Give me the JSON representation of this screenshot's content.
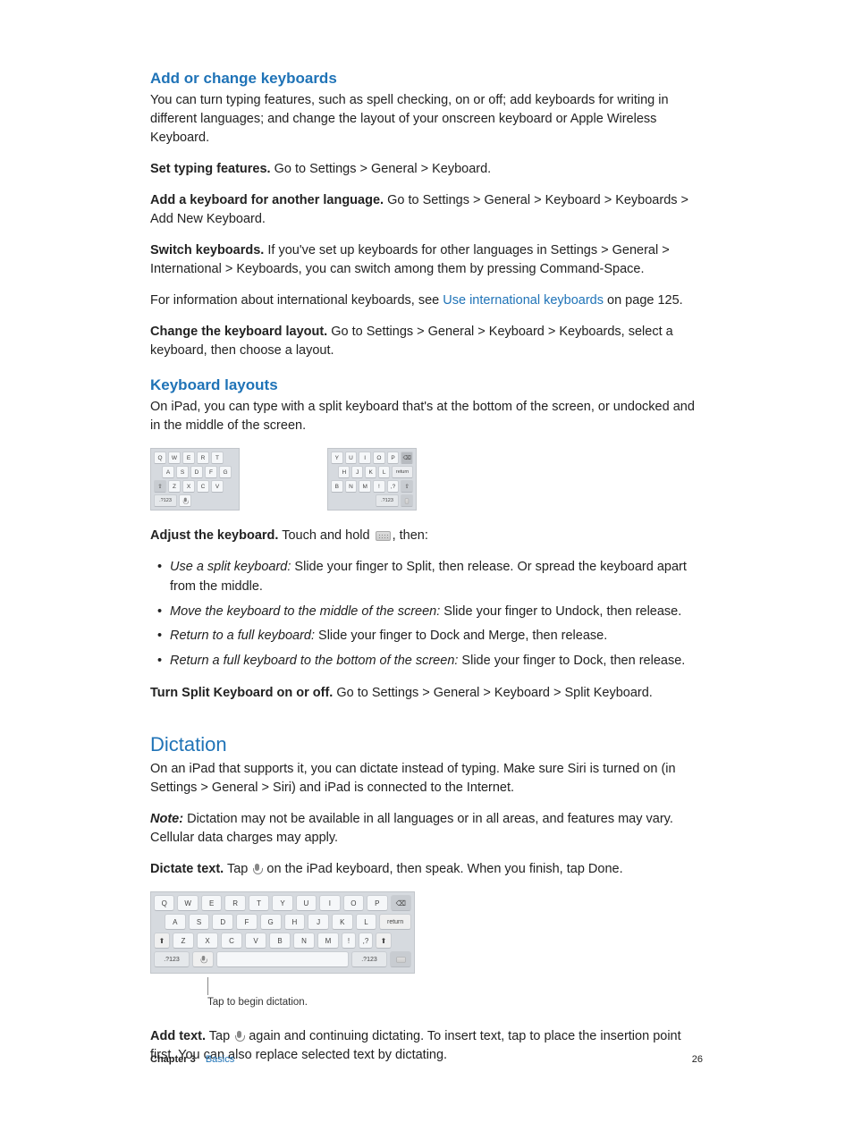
{
  "section1": {
    "heading": "Add or change keyboards",
    "intro": "You can turn typing features, such as spell checking, on or off; add keyboards for writing in different languages; and change the layout of your onscreen keyboard or Apple Wireless Keyboard.",
    "p1_bold": "Set typing features.",
    "p1_rest": " Go to Settings > General > Keyboard.",
    "p2_bold": "Add a keyboard for another language.",
    "p2_rest": " Go to Settings > General > Keyboard > Keyboards > Add New Keyboard.",
    "p3_bold": "Switch keyboards.",
    "p3_rest": " If you've set up keyboards for other languages in Settings > General > International > Keyboards, you can switch among them by pressing Command-Space.",
    "p4_pre": "For information about international keyboards, see ",
    "p4_link": "Use international keyboards",
    "p4_post": " on page 125.",
    "p5_bold": "Change the keyboard layout.",
    "p5_rest": " Go to Settings > General > Keyboard > Keyboards, select a keyboard, then choose a layout."
  },
  "section2": {
    "heading": "Keyboard layouts",
    "intro": "On iPad, you can type with a split keyboard that's at the bottom of the screen, or undocked and in the middle of the screen.",
    "split_left": {
      "row1": [
        "Q",
        "W",
        "E",
        "R",
        "T"
      ],
      "row2": [
        "A",
        "S",
        "D",
        "F",
        "G"
      ],
      "row3": [
        "Z",
        "X",
        "C",
        "V"
      ],
      "row4_num": ".?123"
    },
    "split_right": {
      "row1": [
        "Y",
        "U",
        "I",
        "O",
        "P"
      ],
      "row2": [
        "H",
        "J",
        "K",
        "L"
      ],
      "row2_return": "return",
      "row3": [
        "B",
        "N",
        "M",
        "!",
        ",?"
      ],
      "row4_num": ".?123"
    },
    "adjust_bold": "Adjust the keyboard.",
    "adjust_pre": " Touch and hold ",
    "adjust_post": ", then:",
    "bullets": [
      {
        "em": "Use a split keyboard:",
        "rest": "  Slide your finger to Split, then release. Or spread the keyboard apart from the middle."
      },
      {
        "em": "Move the keyboard to the middle of the screen:",
        "rest": "  Slide your finger to Undock, then release."
      },
      {
        "em": "Return to a full keyboard:",
        "rest": "  Slide your finger to Dock and Merge, then release."
      },
      {
        "em": "Return a full keyboard to the bottom of the screen:",
        "rest": "  Slide your finger to Dock, then release."
      }
    ],
    "turn_bold": "Turn Split Keyboard on or off.",
    "turn_rest": " Go to Settings > General > Keyboard > Split Keyboard."
  },
  "section3": {
    "heading": "Dictation",
    "intro": "On an iPad that supports it, you can dictate instead of typing. Make sure Siri is turned on (in Settings > General > Siri) and iPad is connected to the Internet.",
    "note_em": "Note:",
    "note_rest": "  Dictation may not be available in all languages or in all areas, and features may vary. Cellular data charges may apply.",
    "dictate_bold": "Dictate text.",
    "dictate_pre": " Tap ",
    "dictate_post": " on the iPad keyboard, then speak. When you finish, tap Done.",
    "full_kbd": {
      "row1": [
        "Q",
        "W",
        "E",
        "R",
        "T",
        "Y",
        "U",
        "I",
        "O",
        "P"
      ],
      "row2": [
        "A",
        "S",
        "D",
        "F",
        "G",
        "H",
        "J",
        "K",
        "L"
      ],
      "row2_return": "return",
      "row3": [
        "Z",
        "X",
        "C",
        "V",
        "B",
        "N",
        "M",
        "!",
        ",?"
      ],
      "row4_num": ".?123",
      "row4_num2": ".?123"
    },
    "callout": "Tap to begin dictation.",
    "add_bold": "Add text.",
    "add_pre": " Tap ",
    "add_post": " again and continuing dictating. To insert text, tap to place the insertion point first. You can also replace selected text by dictating."
  },
  "footer": {
    "chapter_label": "Chapter  3",
    "chapter_name": "Basics",
    "page_no": "26"
  }
}
